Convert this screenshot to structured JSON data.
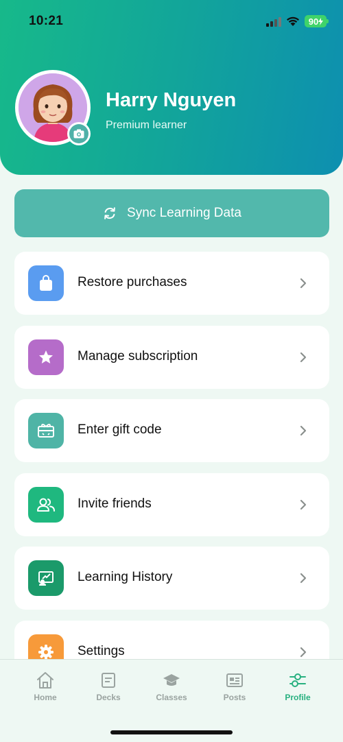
{
  "status_bar": {
    "time": "10:21",
    "battery": "90"
  },
  "profile": {
    "name": "Harry Nguyen",
    "tier": "Premium learner"
  },
  "sync": {
    "label": "Sync Learning Data"
  },
  "menu": [
    {
      "label": "Restore purchases",
      "icon": "shopping-bag-icon",
      "color": "#5a9cf0"
    },
    {
      "label": "Manage subscription",
      "icon": "star-icon",
      "color": "#b56cc9"
    },
    {
      "label": "Enter gift code",
      "icon": "gift-card-icon",
      "color": "#4fb4a6"
    },
    {
      "label": "Invite friends",
      "icon": "people-icon",
      "color": "#1fb87f"
    },
    {
      "label": "Learning History",
      "icon": "history-board-icon",
      "color": "#1b9a6a"
    },
    {
      "label": "Settings",
      "icon": "gear-icon",
      "color": "#f79a3a"
    }
  ],
  "tabs": [
    {
      "label": "Home",
      "icon": "home-icon"
    },
    {
      "label": "Decks",
      "icon": "decks-icon"
    },
    {
      "label": "Classes",
      "icon": "graduation-cap-icon"
    },
    {
      "label": "Posts",
      "icon": "newspaper-icon"
    },
    {
      "label": "Profile",
      "icon": "sliders-icon",
      "active": true
    }
  ],
  "colors": {
    "accent": "#27b07f",
    "header_start": "#17b98a",
    "header_end": "#0d8fb0"
  }
}
